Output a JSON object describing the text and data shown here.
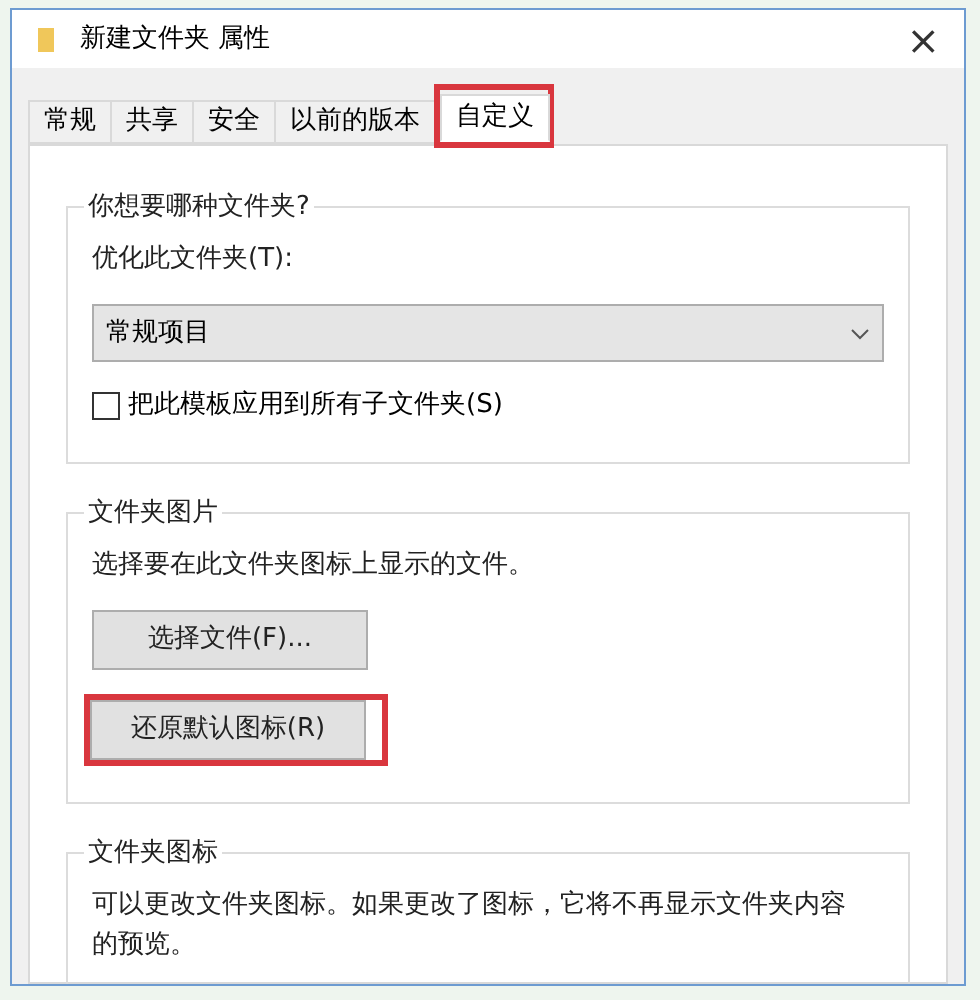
{
  "window": {
    "title": "新建文件夹 属性",
    "close": "×"
  },
  "tabs": [
    {
      "label": "常规",
      "selected": false,
      "highlighted": false
    },
    {
      "label": "共享",
      "selected": false,
      "highlighted": false
    },
    {
      "label": "安全",
      "selected": false,
      "highlighted": false
    },
    {
      "label": "以前的版本",
      "selected": false,
      "highlighted": false
    },
    {
      "label": "自定义",
      "selected": true,
      "highlighted": true
    }
  ],
  "groups": [
    {
      "title": "你想要哪种文件夹?",
      "items": [
        {
          "kind": "label",
          "text": "优化此文件夹(T):"
        },
        {
          "kind": "dropdown",
          "text": "常规项目"
        },
        {
          "kind": "checkbox",
          "text": "把此模板应用到所有子文件夹(S)",
          "checked": false
        }
      ]
    },
    {
      "title": "文件夹图片",
      "items": [
        {
          "kind": "label",
          "text": "选择要在此文件夹图标上显示的文件。"
        },
        {
          "kind": "button",
          "text": "选择文件(F)...",
          "highlighted": false
        },
        {
          "kind": "button",
          "text": "还原默认图标(R)",
          "highlighted": true
        }
      ]
    },
    {
      "title": "文件夹图标",
      "items": [
        {
          "kind": "label",
          "text": "可以更改文件夹图标。如果更改了图标，它将不再显示文件夹内容的预览。"
        }
      ]
    }
  ]
}
